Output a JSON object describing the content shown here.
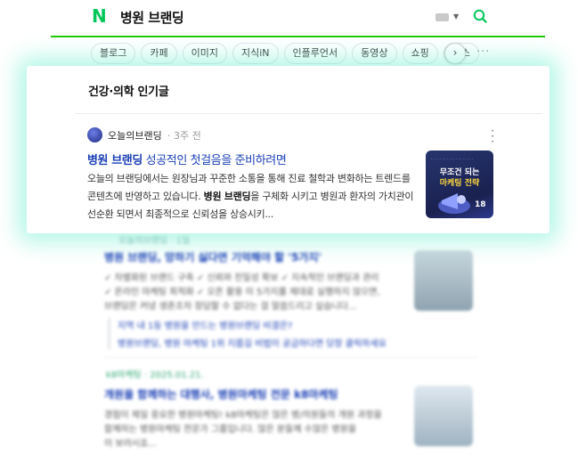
{
  "header": {
    "logo": "N",
    "query": "병원 브랜딩"
  },
  "tabs": [
    "블로그",
    "카페",
    "이미지",
    "지식iN",
    "인플루언서",
    "동영상",
    "쇼핑",
    "뉴스"
  ],
  "tab_next": "›",
  "tab_more": "···",
  "popular": {
    "section_title": "건강·의학 인기글",
    "author": "오늘의브랜딩",
    "time": "· 3주 전",
    "post_title_highlight": "병원 브랜딩",
    "post_title_rest": " 성공적인 첫걸음을 준비하려면",
    "snippet_1": "오늘의 브랜딩에서는 원장님과 꾸준한 소통을 통해 진료 철학과 변화하는 트렌드를 콘텐츠에 반영하고 있습니다. ",
    "snippet_bold": "병원 브랜딩",
    "snippet_2": "을 구체화 시키고 병원과 환자의 가치관이 선순환 되면서 최종적으로 신뢰성을 상승시키...",
    "thumb_big1": "무조건 되는",
    "thumb_big2": "마케팅 전략",
    "thumb_badge": "18"
  },
  "blurred": {
    "r1_author": "오늘의브랜딩 · 1일",
    "r1_title": "병원 브랜딩, 망하기 싫다면 기억해야 할 '5가지'",
    "r1_line1": "✓ 차별화된 브랜드 구축 ✓ 신뢰와 친밀성 확보 ✓ 지속적인 브랜딩과 관리",
    "r1_line2": "✓ 온라인 마케팅 최적화 ✓ 오픈 활용 이 5가지를 제대로 실행하지 않으면,",
    "r1_line3": "브랜딩은 커녕 생존조차 장담할 수 없다는 걸 말씀드리고 싶습니다...",
    "r1_quote1": "지역 내 1등 병원을 만드는 병원브랜딩 비결은?",
    "r1_quote2": "병원브랜딩, 병원 마케팅 1위 지름길 비법이 궁금하다면 당장 클릭하세요",
    "r2_author": "k8마케팅 · 2025.01.21.",
    "r2_title": "개원을 함께하는 대행사, 병원마케팅 전문 k8마케팅",
    "r2_line1": "경험이 제일 중요한 병원마케팅! k8마케팅은 많은 병/의원들의 개원 과정을",
    "r2_line2": "함께하는 병원마케팅 전문가 그룹입니다. 많은 분들께 수많은 병원을",
    "r2_line3": "이 보러시죠..."
  }
}
